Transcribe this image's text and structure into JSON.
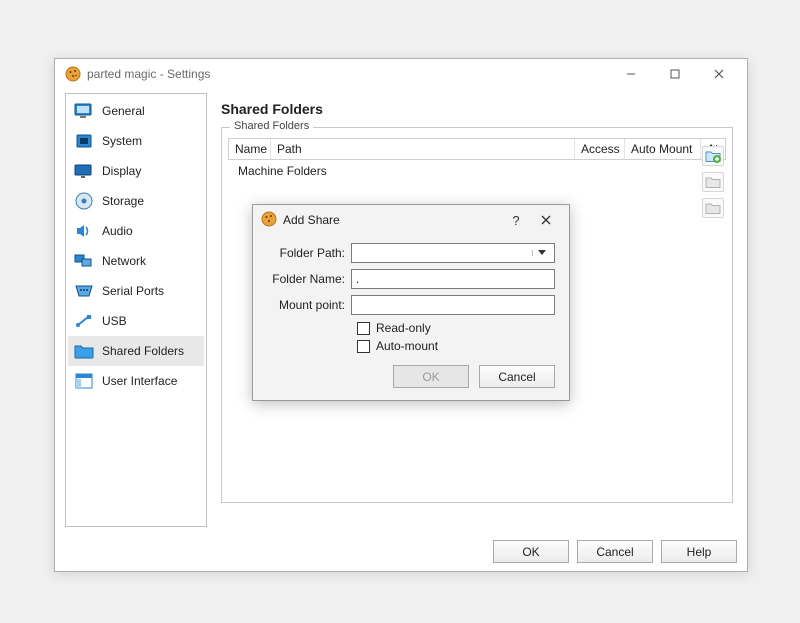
{
  "window": {
    "title": "parted magic - Settings"
  },
  "sidebar": {
    "items": [
      {
        "label": "General"
      },
      {
        "label": "System"
      },
      {
        "label": "Display"
      },
      {
        "label": "Storage"
      },
      {
        "label": "Audio"
      },
      {
        "label": "Network"
      },
      {
        "label": "Serial Ports"
      },
      {
        "label": "USB"
      },
      {
        "label": "Shared Folders"
      },
      {
        "label": "User Interface"
      }
    ]
  },
  "page": {
    "title": "Shared Folders",
    "group_label": "Shared Folders",
    "columns": {
      "name": "Name",
      "path": "Path",
      "access": "Access",
      "auto": "Auto Mount",
      "at": "At"
    },
    "rowgroup": "Machine Folders"
  },
  "buttons": {
    "ok": "OK",
    "cancel": "Cancel",
    "help": "Help"
  },
  "dialog": {
    "title": "Add Share",
    "labels": {
      "path": "Folder Path:",
      "name": "Folder Name:",
      "mount": "Mount point:",
      "readonly": "Read-only",
      "automount": "Auto-mount"
    },
    "values": {
      "path": "",
      "name": ".",
      "mount": ""
    },
    "buttons": {
      "ok": "OK",
      "cancel": "Cancel"
    }
  }
}
